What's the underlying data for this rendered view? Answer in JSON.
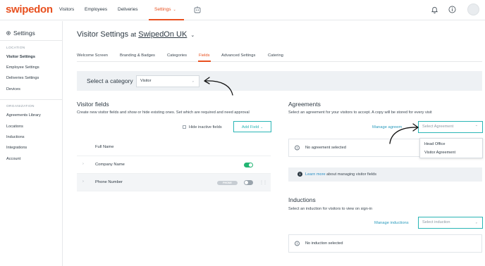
{
  "brand": {
    "logo": "swipedon",
    "accent": "#e8501f",
    "teal": "#2ab5b5"
  },
  "topnav": {
    "items": [
      "Visitors",
      "Employees",
      "Deliveries",
      "Settings"
    ],
    "active": "Settings"
  },
  "sidebar": {
    "title": "Settings",
    "section_location": "LOCATION",
    "location_items": [
      "Visitor Settings",
      "Employee Settings",
      "Deliveries Settings",
      "Devices"
    ],
    "section_organization": "ORGANIZATION",
    "organization_items": [
      "Agreements Library",
      "Locations",
      "Inductions",
      "Integrations",
      "Account"
    ],
    "active": "Visitor Settings"
  },
  "page": {
    "title_prefix": "Visitor Settings",
    "title_at": "at",
    "title_org": "SwipedOn UK"
  },
  "tabs": {
    "items": [
      "Welcome Screen",
      "Branding & Badges",
      "Categories",
      "Fields",
      "Advanced Settings",
      "Catering"
    ],
    "active": "Fields"
  },
  "category": {
    "label": "Select a category",
    "selected": "Visitor"
  },
  "visitor_fields": {
    "title": "Visitor fields",
    "description": "Create new visitor fields and show or hide existing ones. Set which are required and need approval",
    "hide_inactive_label": "Hide inactive fields",
    "add_field_label": "Add Field",
    "rows": [
      {
        "name": "Full Name"
      },
      {
        "name": "Company Name"
      },
      {
        "name": "Phone Number",
        "badge": "PHONE"
      }
    ]
  },
  "agreements": {
    "title": "Agreements",
    "description": "Select an agreement for your visitors to accept. A copy will be stored for every visit",
    "manage_label": "Manage agreem",
    "select_placeholder": "Select Agreement",
    "dropdown_options": [
      "Head Office",
      "Visitor Agreement"
    ],
    "empty_text": "No agreement selected"
  },
  "info": {
    "link": "Learn more",
    "text": "about managing visitor fields"
  },
  "inductions": {
    "title": "Inductions",
    "description": "Select an induction for visitors to view on sign-in",
    "manage_label": "Manage inductions",
    "select_placeholder": "Select induction",
    "empty_text": "No induction selected"
  }
}
